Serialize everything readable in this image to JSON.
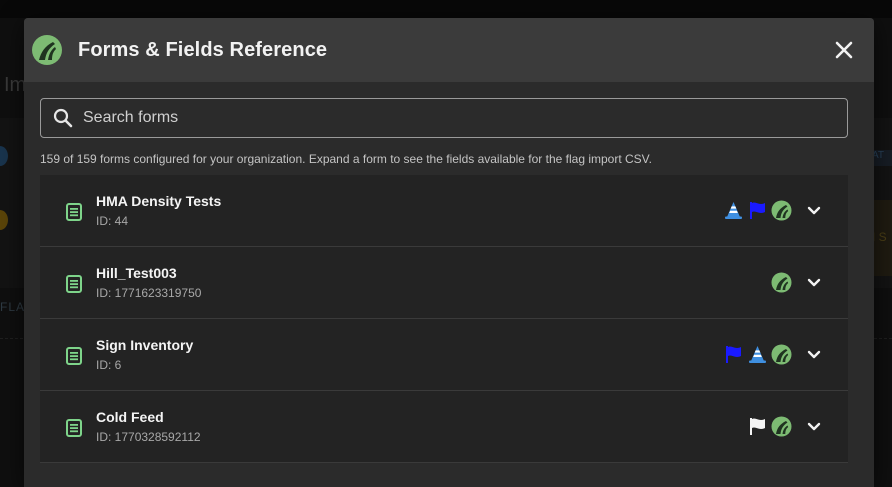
{
  "background": {
    "title_fragment": "Im",
    "flag_fragment": "FLAG",
    "right_fragment_1": "AT",
    "right_fragment_2": "I S"
  },
  "dialog": {
    "title": "Forms & Fields Reference",
    "close_icon": "close-icon",
    "logo_icon": "road-logo-icon"
  },
  "search": {
    "placeholder": "Search forms",
    "value": ""
  },
  "summary_text": "159 of 159 forms configured for your organization. Expand a form to see the fields available for the flag import CSV.",
  "colors": {
    "accent_green": "#7dbb73",
    "flag_blue": "#1a1aff",
    "cone_blue": "#3f8fe0",
    "doc_green": "#7ed48a"
  },
  "forms": [
    {
      "name": "HMA Density Tests",
      "id": "ID: 44",
      "badges": [
        "cone-icon",
        "blue-flag-icon",
        "road-logo-icon"
      ]
    },
    {
      "name": "Hill_Test003",
      "id": "ID: 1771623319750",
      "badges": [
        "road-logo-icon"
      ]
    },
    {
      "name": "Sign Inventory",
      "id": "ID: 6",
      "badges": [
        "blue-flag-icon",
        "cone-icon",
        "road-logo-icon"
      ]
    },
    {
      "name": "Cold Feed",
      "id": "ID: 1770328592112",
      "badges": [
        "white-flag-icon",
        "road-logo-icon"
      ]
    }
  ]
}
